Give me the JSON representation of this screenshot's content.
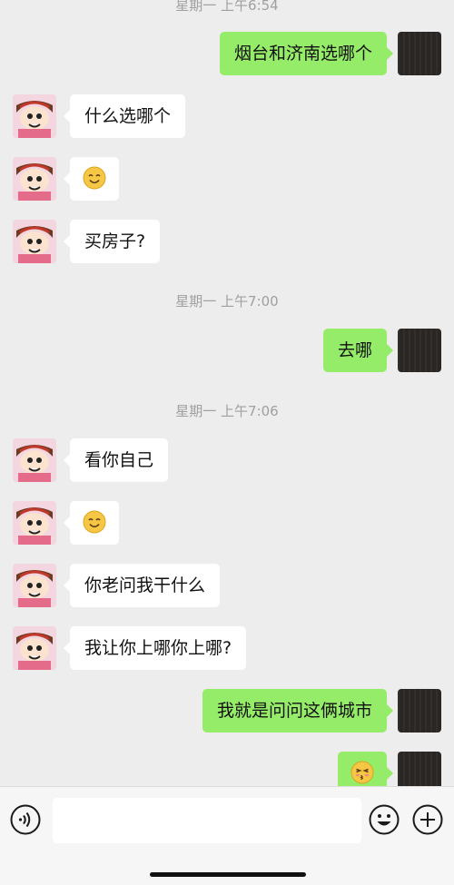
{
  "messages": [
    {
      "type": "timestamp",
      "text": "星期一 上午6:54"
    },
    {
      "type": "text",
      "sender": "me",
      "text": "烟台和济南选哪个"
    },
    {
      "type": "text",
      "sender": "other",
      "text": "什么选哪个"
    },
    {
      "type": "emoji",
      "sender": "other",
      "emoji": "smile-face"
    },
    {
      "type": "text",
      "sender": "other",
      "text": "买房子?"
    },
    {
      "type": "timestamp",
      "text": "星期一 上午7:00"
    },
    {
      "type": "text",
      "sender": "me",
      "text": "去哪"
    },
    {
      "type": "timestamp",
      "text": "星期一 上午7:06"
    },
    {
      "type": "text",
      "sender": "other",
      "text": "看你自己"
    },
    {
      "type": "emoji",
      "sender": "other",
      "emoji": "smile-face"
    },
    {
      "type": "text",
      "sender": "other",
      "text": "你老问我干什么"
    },
    {
      "type": "text",
      "sender": "other",
      "text": "我让你上哪你上哪?"
    },
    {
      "type": "text",
      "sender": "me",
      "text": "我就是问问这俩城市"
    },
    {
      "type": "emoji",
      "sender": "me",
      "emoji": "kissing-face"
    }
  ],
  "input_bar": {
    "voice_icon": "voice-icon",
    "emoji_icon": "emoji-icon",
    "plus_icon": "plus-icon",
    "input_value": ""
  },
  "colors": {
    "background": "#ededed",
    "bubble_me": "#95ec69",
    "bubble_other": "#ffffff",
    "timestamp": "#a0a0a0"
  }
}
